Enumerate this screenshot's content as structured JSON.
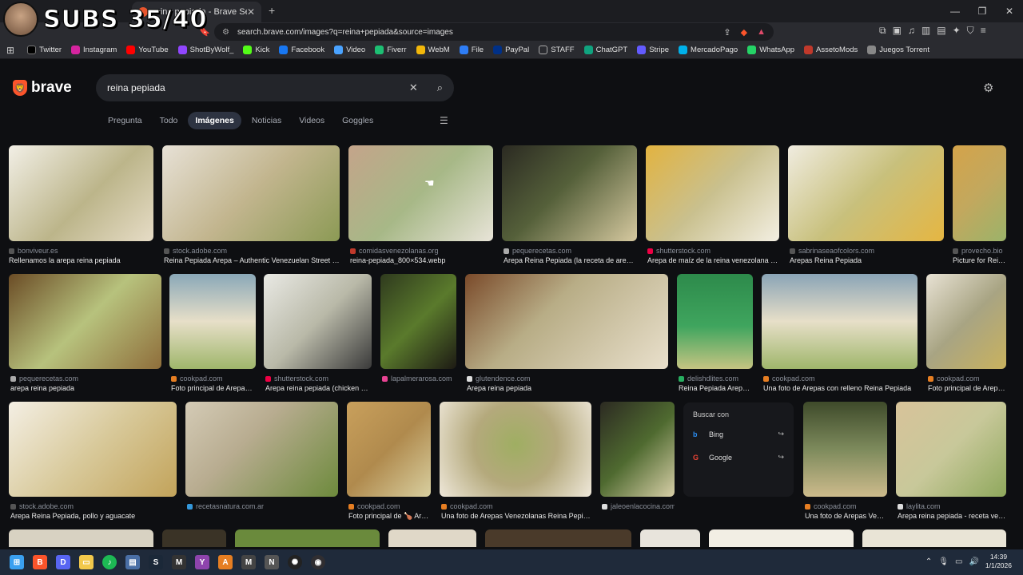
{
  "overlay": {
    "subs_text": "SUBS 35/40"
  },
  "browser": {
    "tab_title": "reina pepiada - Brave Search",
    "tab_close": "✕",
    "new_tab": "+",
    "url": "search.brave.com/images?q=reina+pepiada&source=images",
    "bookmarks": [
      {
        "label": "Twitter",
        "color": "#000000"
      },
      {
        "label": "Instagram",
        "color": "#d6249f"
      },
      {
        "label": "YouTube",
        "color": "#ff0000"
      },
      {
        "label": "ShotByWolf_",
        "color": "#9146ff"
      },
      {
        "label": "Kick",
        "color": "#53fc18"
      },
      {
        "label": "Facebook",
        "color": "#1877f2"
      },
      {
        "label": "Video",
        "color": "#4aa3ff"
      },
      {
        "label": "Fiverr",
        "color": "#1dbf73"
      },
      {
        "label": "WebM",
        "color": "#f2b70a"
      },
      {
        "label": "File",
        "color": "#2e7df6"
      },
      {
        "label": "PayPal",
        "color": "#003087"
      },
      {
        "label": "STAFF",
        "color": "#555555"
      },
      {
        "label": "ChatGPT",
        "color": "#10a37f"
      },
      {
        "label": "Stripe",
        "color": "#635bff"
      },
      {
        "label": "MercadoPago",
        "color": "#00b1ea"
      },
      {
        "label": "WhatsApp",
        "color": "#25d366"
      },
      {
        "label": "AssetoMods",
        "color": "#c0392b"
      },
      {
        "label": "Juegos Torrent",
        "color": "#888888"
      }
    ]
  },
  "page": {
    "logo": "brave",
    "search_value": "reina pepiada",
    "tabs": [
      "Pregunta",
      "Todo",
      "Imágenes",
      "Noticias",
      "Videos",
      "Goggles"
    ],
    "active_tab": "Imágenes",
    "results": {
      "row1": [
        {
          "source": "bonviveur.es",
          "caption": "Rellenamos la arepa reina pepiada",
          "color": "#bcb58a"
        },
        {
          "source": "stock.adobe.com",
          "caption": "Reina Pepiada Arepa – Authentic Venezuelan Street Foo...",
          "color": "#c2b58e"
        },
        {
          "source": "comidasvenezolanas.org",
          "caption": "reina-pepiada_800×534.webp",
          "color": "#a7b887"
        },
        {
          "source": "pequerecetas.com",
          "caption": "Arepa Reina Pepiada (la receta de arepa v...",
          "color": "#55603a"
        },
        {
          "source": "shutterstock.com",
          "caption": "Arepa de maíz de la reina venezolana pep...",
          "color": "#c9c08e"
        },
        {
          "source": "sabrinaseaofcolors.com",
          "caption": "Arepas Reina Pepiada",
          "color": "#c8c07c"
        },
        {
          "source": "provecho.bio",
          "caption": "Picture for Rein...",
          "color": "#c2a85e"
        }
      ],
      "row2": [
        {
          "source": "pequerecetas.com",
          "caption": "arepa reina pepiada",
          "color": "#8f6e3b"
        },
        {
          "source": "cookpad.com",
          "caption": "Foto principal de Arepas ...",
          "color": "#8aa8b8"
        },
        {
          "source": "shutterstock.com",
          "caption": "Arepa reina pepiada (chicken av...",
          "color": "#b9b9a8"
        },
        {
          "source": "lapalmerarosa.com",
          "caption": "",
          "color": "#3b4a26"
        },
        {
          "source": "glutendence.com",
          "caption": "Arepa reina pepiada",
          "color": "#b8ad86"
        },
        {
          "source": "delishdlites.com",
          "caption": "Reina Pepiada Arepas ...",
          "color": "#2d8a4b"
        },
        {
          "source": "cookpad.com",
          "caption": "Una foto de Arepas con relleno Reina Pepiada",
          "color": "#8aa4b6"
        },
        {
          "source": "cookpad.com",
          "caption": "Foto principal de Arepa...",
          "color": "#a8a483"
        }
      ],
      "row3": [
        {
          "source": "stock.adobe.com",
          "caption": "Arepa Reina Pepiada, pollo y aguacate",
          "color": "#d8c99a"
        },
        {
          "source": "recetasnatura.com.ar",
          "caption": "",
          "color": "#b8ac90"
        },
        {
          "source": "cookpad.com",
          "caption": "Foto principal de 🍗 Are...",
          "color": "#b08a4d"
        },
        {
          "source": "cookpad.com",
          "caption": "Una foto de Arepas Venezolanas Reina Pepiada",
          "color": "#b4a97c"
        },
        {
          "source": "jaleoenlacocina.com",
          "caption": "",
          "color": "#4f6a30"
        },
        {
          "source": "cookpad.com",
          "caption": "Una foto de Arepas Vene...",
          "color": "#7d8a5c"
        },
        {
          "source": "laylita.com",
          "caption": "Arepa reina pepiada - receta vene...",
          "color": "#c8c89a"
        }
      ]
    },
    "popup": {
      "title": "Buscar con",
      "options": [
        "Bing",
        "Google"
      ]
    }
  },
  "taskbar": {
    "time": "14:39",
    "date": "1/1/2026"
  }
}
